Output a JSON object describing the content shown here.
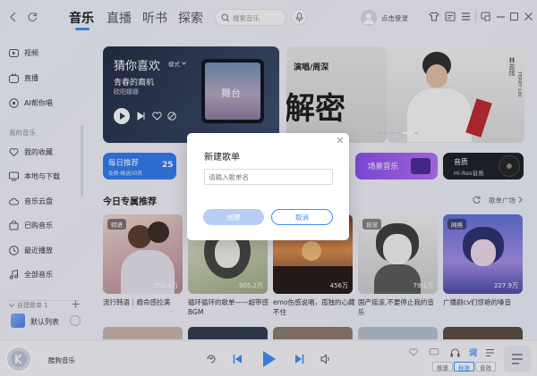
{
  "header": {
    "tabs": [
      "音乐",
      "直播",
      "听书",
      "探索"
    ],
    "search_placeholder": "搜索音乐",
    "login_label": "点击登录"
  },
  "sidebar": {
    "top_items": [
      "视频",
      "直播",
      "AI帮你唱"
    ],
    "my_music_label": "我的音乐",
    "my_items": [
      "我的收藏",
      "本地与下载",
      "音乐云盘",
      "已购音乐",
      "最近播放",
      "全部音乐"
    ],
    "playlist_section_label": "自建歌单 1",
    "playlist_items": [
      "默认列表"
    ]
  },
  "banner": {
    "guess_title": "猜你喜欢",
    "mode_label": "模式",
    "guess_song": "青春的裔机",
    "guess_artist": "欧阳娜娜",
    "album_text": "舞台",
    "poster_text": "演唱/周深",
    "poster_big": "解密",
    "side_title": "林志炫",
    "side_sub": "TERRY LIN"
  },
  "categories": {
    "daily_title": "每日推荐",
    "daily_sub": "免费·精选30首",
    "daily_date": "25",
    "scene": "场景音乐",
    "hires_title": "音质",
    "hires_sub": "Hi-Res音质"
  },
  "section": {
    "title": "今日专属推荐",
    "plaza_label": "歌单广场"
  },
  "playlists": [
    {
      "badge": "韩语",
      "plays": "259.8万",
      "caption": "流行韩语｜瘾命感拉满"
    },
    {
      "badge": "",
      "plays": "905.2万",
      "caption": "循环循环的歌单——超带感BGM"
    },
    {
      "badge": "",
      "plays": "456万",
      "caption": "emo伤感说唱，孤独的心藏不住"
    },
    {
      "badge": "摇滚",
      "plays": "79.1万",
      "caption": "国产摇滚,不要停止我的音乐"
    },
    {
      "badge": "网络",
      "plays": "227.9万",
      "caption": "广播剧cv们惊艳的嗓音"
    }
  ],
  "modal": {
    "title": "新建歌单",
    "input_placeholder": "请输入歌单名",
    "create_label": "创建",
    "cancel_label": "取消"
  },
  "player": {
    "track_title": "酷狗音乐",
    "lyrics_label": "词",
    "btn_stream": "极速",
    "btn_standard": "标准",
    "btn_sound": "音效"
  },
  "colors": {
    "accent": "#3b8ff5",
    "daily_bg": "#2f7bef",
    "scene_bg": "#a05cf0",
    "hires_bg": "#1a1d24"
  }
}
